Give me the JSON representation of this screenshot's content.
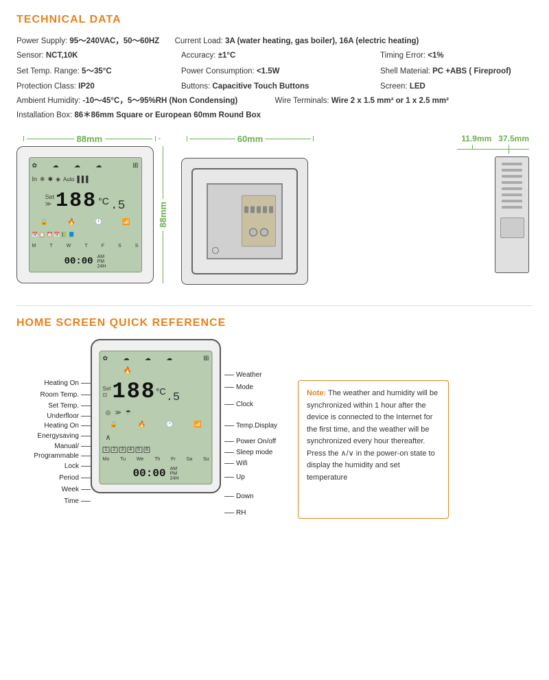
{
  "page": {
    "background": "#ffffff"
  },
  "technical_data": {
    "title": "TECHNICAL DATA",
    "specs": [
      {
        "col1_label": "Power Supply:",
        "col1_value": "95～240VAC，50～60HZ",
        "col2_label": "Current Load:",
        "col2_value": "3A (water heating, gas boiler), 16A (electric heating)",
        "col3_label": "",
        "col3_value": ""
      },
      {
        "col1_label": "Sensor:",
        "col1_value": "NCT,10K",
        "col2_label": "Accuracy:",
        "col2_value": "±1°C",
        "col3_label": "Timing Error:",
        "col3_value": "<1%"
      },
      {
        "col1_label": "Set Temp. Range:",
        "col1_value": "5～35°C",
        "col2_label": "Power Consumption:",
        "col2_value": "<1.5W",
        "col3_label": "Shell Material:",
        "col3_value": "PC +ABS  ( Fireproof)"
      },
      {
        "col1_label": "Protection Class:",
        "col1_value": "IP20",
        "col2_label": "Buttons:",
        "col2_value": "Capacitive Touch Buttons",
        "col3_label": "Screen:",
        "col3_value": "LED"
      },
      {
        "col1_label": "Ambient Humidity:",
        "col1_value": "-10～45°C，5～95%RH  (Non Condensing)",
        "col2_label": "",
        "col2_value": "",
        "col3_label": "Wire Terminals:",
        "col3_value": "Wire 2 x 1.5 mm² or 1 x 2.5 mm²"
      },
      {
        "col1_label": "Installation Box:",
        "col1_value": "86＊86mm Square or European 60mm Round Box",
        "col2_label": "",
        "col2_value": "",
        "col3_label": "",
        "col3_value": ""
      }
    ]
  },
  "diagrams": {
    "front": {
      "width_label": "88mm",
      "height_label": "88mm",
      "lcd_temp": "188",
      "lcd_decimal": ".5",
      "lcd_unit": "°C"
    },
    "back": {
      "width_label": "60mm"
    },
    "side": {
      "dim1_label": "11.9mm",
      "dim2_label": "37.5mm"
    }
  },
  "home_screen": {
    "title": "HOME SCREEN QUICK REFERENCE",
    "labels_left": [
      "Heating On",
      "Room Temp.",
      "Set Temp.",
      "Underfloor",
      "Heating On",
      "Energysaving",
      "Manual/",
      "Programmable",
      "Lock",
      "Period",
      "Week",
      "Time"
    ],
    "labels_right": [
      "Weather",
      "Mode",
      "Clock",
      "Temp.Display",
      "Power On/off",
      "Sleep mode",
      "Wifi",
      "Up",
      "Down",
      "RH"
    ],
    "note_title": "Note:",
    "note_text": "The weather and humidity will be synchronized within 1 hour after the device is connected to the Internet for the first time, and the weather will be synchronized every hour thereafter. Press the ∧/∨ in the power-on state to display the humidity and set temperature"
  }
}
